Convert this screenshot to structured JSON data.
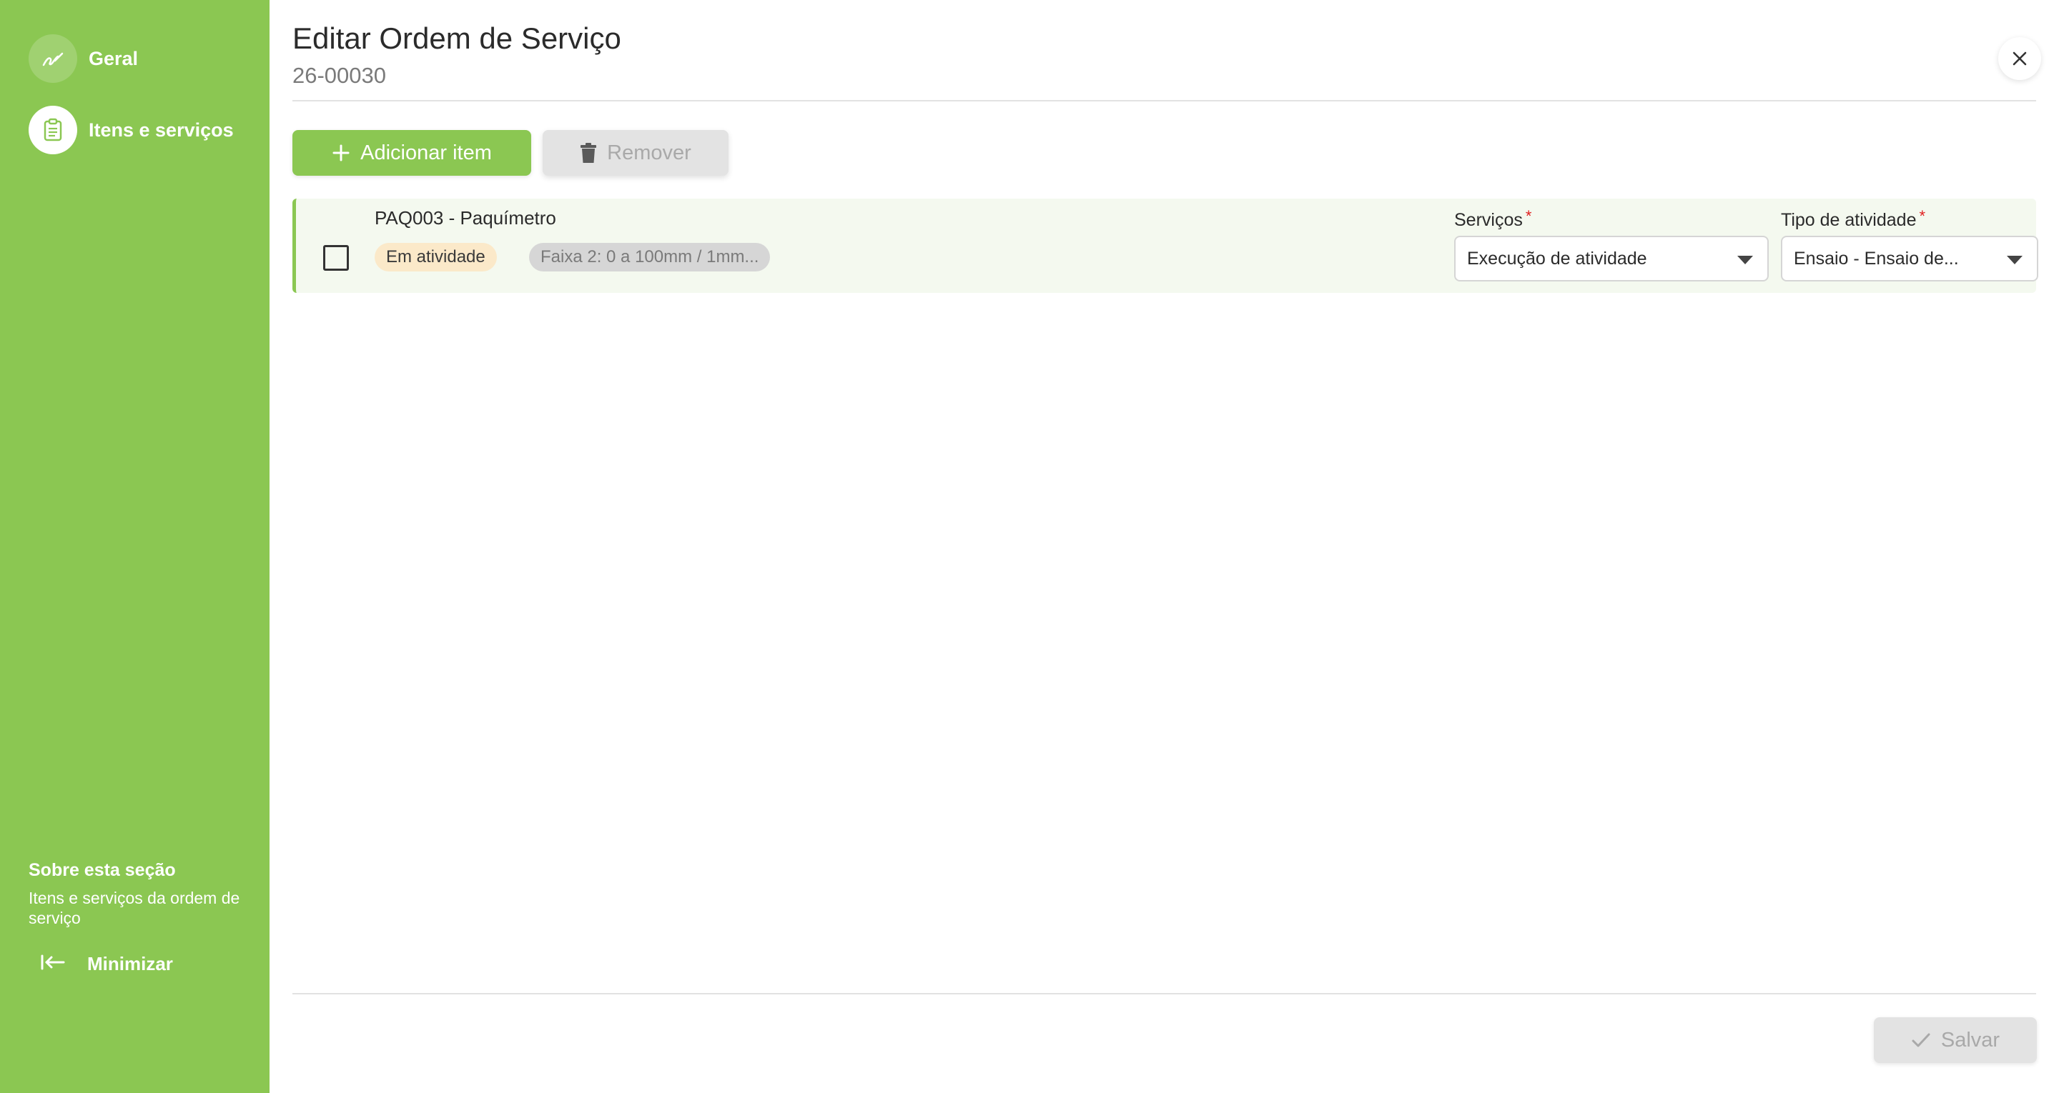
{
  "sidebar": {
    "items": [
      {
        "label": "Geral",
        "icon": "signature-icon"
      },
      {
        "label": "Itens e serviços",
        "icon": "clipboard-icon"
      }
    ],
    "about_title": "Sobre esta seção",
    "about_desc": "Itens e serviços da ordem de serviço",
    "minimize_label": "Minimizar"
  },
  "header": {
    "title": "Editar Ordem de Serviço",
    "subtitle": "26-00030"
  },
  "toolbar": {
    "add_label": "Adicionar item",
    "remove_label": "Remover"
  },
  "items": [
    {
      "name": "PAQ003 - Paquímetro",
      "status": "Em atividade",
      "range": "Faixa 2: 0 a 100mm / 1mm...",
      "services_label": "Serviços",
      "services_value": "Execução de atividade",
      "activity_label": "Tipo de atividade",
      "activity_value": "Ensaio - Ensaio de..."
    }
  ],
  "footer": {
    "save_label": "Salvar"
  },
  "colors": {
    "accent": "#8bc752",
    "status_chip": "#fbe9c9",
    "required": "#e02020"
  }
}
